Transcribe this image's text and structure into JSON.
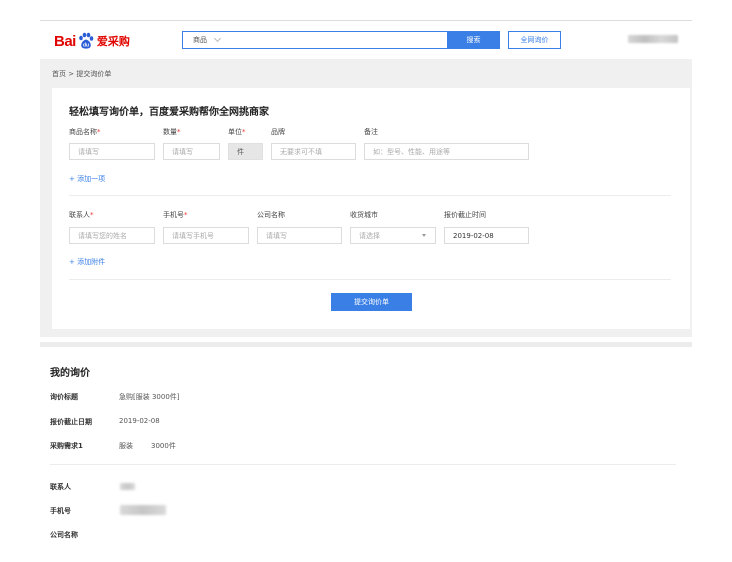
{
  "header": {
    "logo_text": "Bai",
    "logo_paw_text": "du",
    "logo_sub": "爱采购",
    "search_category": "商品",
    "search_button": "搜索",
    "all_inquiry_button": "全网询价"
  },
  "breadcrumb": "首页 > 提交询价单",
  "form": {
    "title": "轻松填写询价单，百度爱采购帮你全网挑商家",
    "labels": {
      "product_name": "商品名称",
      "quantity": "数量",
      "unit": "单位",
      "brand": "品牌",
      "remark": "备注"
    },
    "required_mark": "*",
    "placeholders": {
      "product_name": "请填写",
      "quantity": "请填写",
      "brand": "无要求可不填",
      "remark": "如：型号、性能、用途等"
    },
    "unit_value": "件",
    "add_item": "+ 添加一项",
    "contact_labels": {
      "contact": "联系人",
      "phone": "手机号",
      "company": "公司名称",
      "city": "收货城市",
      "deadline": "报价截止时间"
    },
    "contact_placeholders": {
      "contact": "请填写您的姓名",
      "phone": "请填写手机号",
      "company": "请填写",
      "city": "请选择"
    },
    "deadline_value": "2019-02-08",
    "add_attachment": "+ 添加附件",
    "submit": "提交询价单"
  },
  "my_inquiry": {
    "title": "我的询价",
    "rows": [
      {
        "key": "询价标题",
        "value": "急购[服装 3000件]"
      },
      {
        "key": "报价截止日期",
        "value": "2019-02-08"
      },
      {
        "key": "采购需求1",
        "value": "服装",
        "value2": "3000件"
      }
    ],
    "contact_rows": [
      {
        "key": "联系人"
      },
      {
        "key": "手机号"
      },
      {
        "key": "公司名称"
      }
    ]
  }
}
